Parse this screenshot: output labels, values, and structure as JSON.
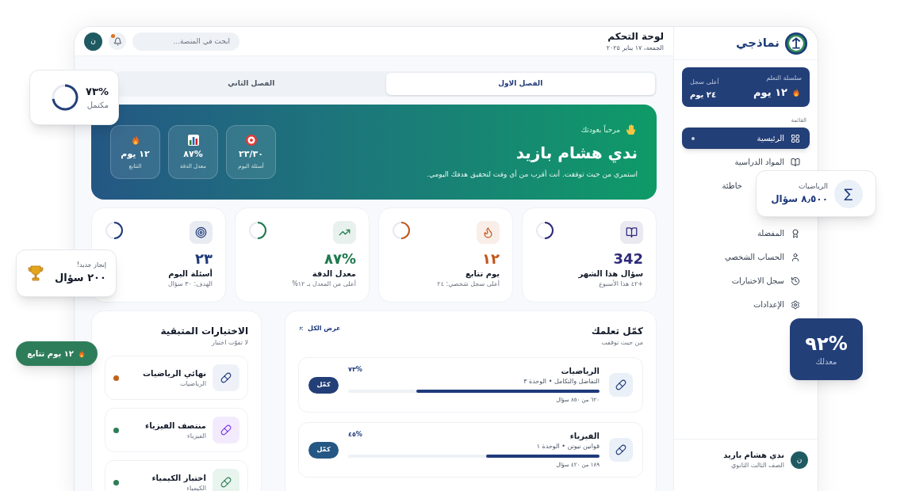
{
  "sidebar": {
    "logo_text": "نماذجي",
    "streak": {
      "label": "سلسلة التعلم",
      "value": "١٢ يوم",
      "best_label": "أعلى سجل",
      "best_value": "٢٤ يوم"
    },
    "menu_label": "القائمة",
    "items": [
      {
        "label": "الرئيسية",
        "selected": true,
        "cut": false
      },
      {
        "label": "المواد الدراسية",
        "selected": false,
        "cut": false
      },
      {
        "label": "خاطئة",
        "selected": false,
        "cut": true
      },
      {
        "label": "المفضلة",
        "selected": false,
        "cut": false
      },
      {
        "label": "الحساب الشخصي",
        "selected": false,
        "cut": false
      },
      {
        "label": "سجل الاختبارات",
        "selected": false,
        "cut": false
      },
      {
        "label": "الإعدادات",
        "selected": false,
        "cut": false
      }
    ],
    "user": {
      "avatar": "ن",
      "name": "ندي هشام بازيد",
      "grade": "الصف الثالث الثانوي"
    }
  },
  "header": {
    "title": "لوحة التحكم",
    "date": "الجمعة، ١٧ يناير ٢٠٢٥",
    "search_placeholder": "ابحث في المنصة...",
    "notification": true,
    "avatar": "ن"
  },
  "tabs": [
    {
      "label": "الفصل الاول",
      "selected": true
    },
    {
      "label": "الفصل الثاني",
      "selected": false
    }
  ],
  "hero": {
    "greeting": "مرحباً بعودتك",
    "name": "ندي هشام بازيد",
    "message": "استمري من حيث توقفت. أنت أقرب من أي وقت لتحقيق هدفك اليومي.",
    "stats": [
      {
        "kind": "target",
        "value": "٢٣/٣٠",
        "label": "أسئلة اليوم"
      },
      {
        "kind": "chart",
        "value": "٨٧%",
        "label": "معدل الدقة"
      },
      {
        "kind": "flame",
        "value": "١٢ يوم",
        "label": "التتابع"
      }
    ]
  },
  "stat_cards": [
    {
      "kind": "book",
      "value": "342",
      "label": "سؤال هذا الشهر",
      "sub": "+٤٢ هذا الأسبوع",
      "color": "#2e2a7a"
    },
    {
      "kind": "flame",
      "value": "١٢",
      "label": "يوم تتابع",
      "sub": "أعلى سجل شخصي: ٢٤",
      "color": "#c2571a"
    },
    {
      "kind": "trend",
      "value": "٨٧%",
      "label": "معدل الدقة",
      "sub": "أعلى من المعدل بـ ١٢%",
      "color": "#1f7a4d"
    },
    {
      "kind": "target",
      "value": "٢٣",
      "label": "أسئلة اليوم",
      "sub": "الهدف: ٣٠ سؤال",
      "color": "#1e3a7a"
    }
  ],
  "continue": {
    "title": "كمّل تعلمك",
    "subtitle": "من حيث توقفت",
    "view_all": "عرض الكل",
    "courses": [
      {
        "title": "الرياضيات",
        "sub": "التفاضل والتكامل • الوحدة ٣",
        "percent": "٧٣%",
        "level": 0.73,
        "count": "٦٢٠ من ٨٥٠ سؤال",
        "button": "كمّل"
      },
      {
        "title": "الفيزياء",
        "sub": "قوانين نيوتن • الوحدة ١",
        "percent": "٤٥%",
        "level": 0.45,
        "count": "١٨٩ من ٤٢٠ سؤال",
        "button": "كمّل"
      }
    ]
  },
  "tests": {
    "title": "الاختبارات المتبقية",
    "subtitle": "لا تفوّت اختبار",
    "items": [
      {
        "title": "نهائي الرياضيات",
        "sub": "الرياضيات",
        "color": "#c2621a"
      },
      {
        "title": "منتصف الفيزياء",
        "sub": "الفيزياء",
        "color": "#2e7d55"
      },
      {
        "title": "اختبار الكيمياء",
        "sub": "الكيمياء",
        "color": "#2e7d55"
      }
    ]
  },
  "floating": {
    "progress": {
      "value": "٧٣%",
      "label": "مكتمل"
    },
    "achievement": {
      "label": "إنجاز جديد!",
      "value": "٢٠٠ سؤال"
    },
    "streak_pill": {
      "text": "١٢ يوم تتابع"
    },
    "subject": {
      "label": "الرياضيات",
      "value": "٨٫٥٠٠ سؤال",
      "symbol": "∑"
    },
    "average": {
      "value": "٩٢%",
      "label": "معدلك"
    }
  }
}
